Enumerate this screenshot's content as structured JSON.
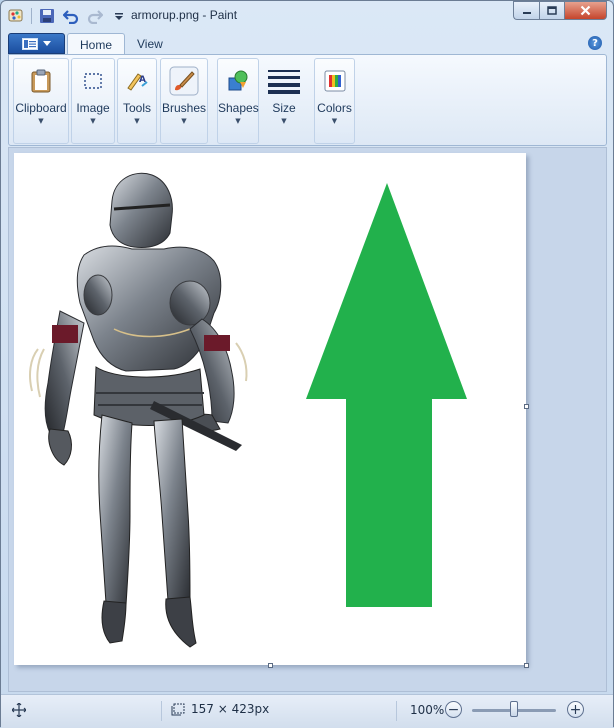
{
  "window": {
    "title": "armorup.png - Paint"
  },
  "tabs": {
    "home": "Home",
    "view": "View"
  },
  "ribbon": {
    "groups": [
      {
        "label": "Clipboard",
        "icon": "clipboard-icon"
      },
      {
        "label": "Image",
        "icon": "select-icon"
      },
      {
        "label": "Tools",
        "icon": "tools-icon"
      },
      {
        "label": "Brushes",
        "icon": "brush-icon"
      },
      {
        "label": "Shapes",
        "icon": "shapes-icon"
      },
      {
        "label": "Size",
        "icon": "size-lines-icon"
      },
      {
        "label": "Colors",
        "icon": "color-palette-icon"
      }
    ]
  },
  "canvas": {
    "arrow_color": "#22b14c",
    "background": "#ffffff"
  },
  "status": {
    "dimensions": "157 × 423px",
    "zoom": "100%",
    "zoom_level": 1.0
  }
}
